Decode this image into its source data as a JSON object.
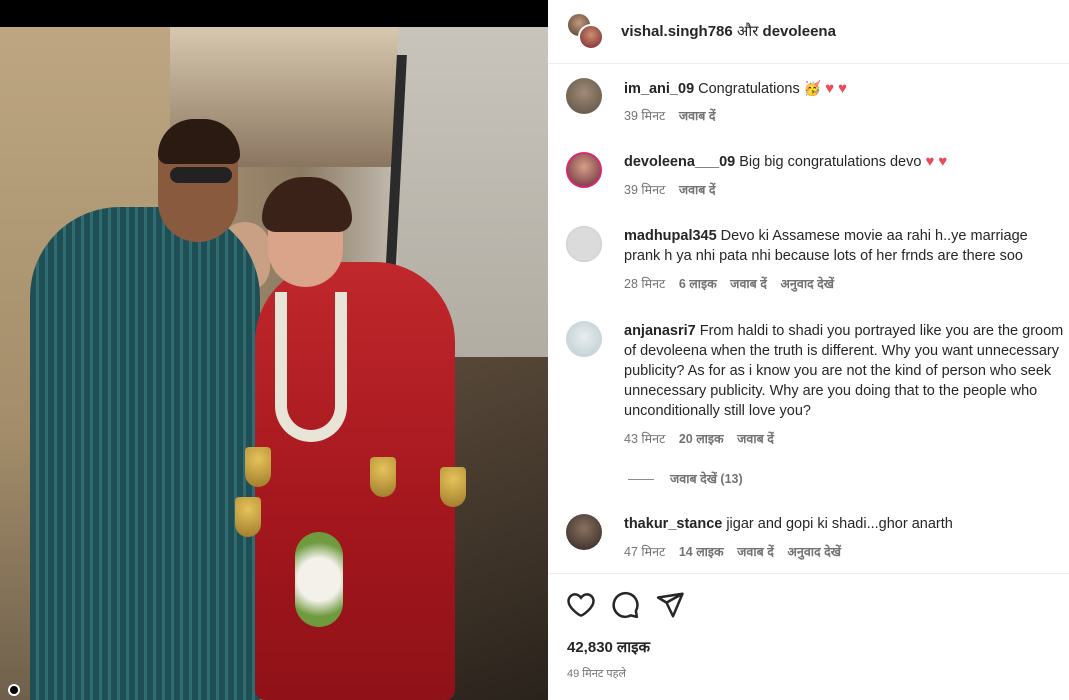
{
  "header": {
    "username1": "vishal.singh786",
    "joiner": "और",
    "username2": "devoleena"
  },
  "comments": [
    {
      "username": "im_ani_09",
      "text": "Congratulations",
      "time": "39 मिनट",
      "likes": "",
      "reply": "जवाब दें",
      "translate": ""
    },
    {
      "username": "devoleena___09",
      "text": "Big big congratulations devo",
      "time": "39 मिनट",
      "likes": "",
      "reply": "जवाब दें",
      "translate": ""
    },
    {
      "username": "madhupal345",
      "text": "Devo ki Assamese movie aa rahi h..ye marriage prank h ya nhi pata nhi because lots of her frnds are there soo",
      "time": "28 मिनट",
      "likes": "6 लाइक",
      "reply": "जवाब दें",
      "translate": "अनुवाद देखें"
    },
    {
      "username": "anjanasri7",
      "text": "From haldi to shadi you portrayed like you are the groom of devoleena when the truth is different. Why you want unnecessary publicity? As for as i know you are not the kind of person who seek unnecessary publicity. Why are you doing that to the people who unconditionally still love you?",
      "time": "43 मिनट",
      "likes": "20 लाइक",
      "reply": "जवाब दें",
      "translate": ""
    },
    {
      "username": "thakur_stance",
      "text": "jigar and gopi ki shadi...ghor anarth",
      "time": "47 मिनट",
      "likes": "14 लाइक",
      "reply": "जवाब दें",
      "translate": "अनुवाद देखें"
    }
  ],
  "view_replies": "जवाब देखें (13)",
  "post": {
    "likes": "42,830 लाइक",
    "posted": "49 मिनट पहले"
  },
  "icons": {
    "like": "heart-icon",
    "comment": "comment-icon",
    "share": "share-icon"
  },
  "colors": {
    "heart": "#ed4956",
    "muted": "#737373",
    "text": "#262626"
  }
}
